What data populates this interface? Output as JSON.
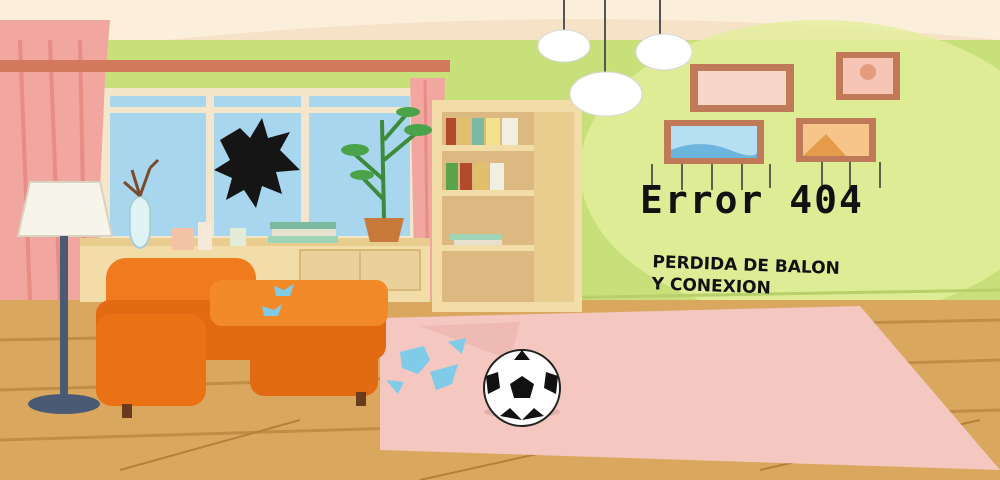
{
  "error": {
    "title": "Error 404",
    "subtitle_line1": "PERDIDA DE BALON",
    "subtitle_line2": "Y CONEXION"
  },
  "colors": {
    "wall": "#c8e07a",
    "curtain": "#f2a6a0",
    "floor": "#d9a85e",
    "armchair": "#f07a1e",
    "rug": "#f5c7c1",
    "ceiling": "#f6e2c6"
  }
}
